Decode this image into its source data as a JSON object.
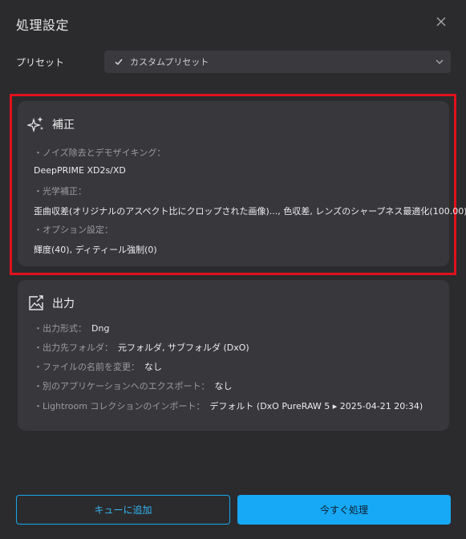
{
  "dialog": {
    "title": "処理設定"
  },
  "preset": {
    "label": "プリセット",
    "value": "カスタムプリセット"
  },
  "correction": {
    "heading": "補正",
    "noise_label": "・ノイズ除去とデモザイキング：",
    "noise_value": "DeepPRIME XD2s/XD",
    "optical_label": "・光学補正：",
    "optical_value": "歪曲収差(オリジナルのアスペクト比にクロップされた画像)..., 色収差, レンズのシャープネス最適化(100.00)",
    "options_label": "・オプション設定：",
    "options_value": "輝度(40), ディティール強制(0)"
  },
  "output": {
    "heading": "出力",
    "rows": [
      {
        "label": "・出力形式：",
        "value": "Dng"
      },
      {
        "label": "・出力先フォルダ：",
        "value": "元フォルダ, サブフォルダ (DxO)"
      },
      {
        "label": "・ファイルの名前を変更：",
        "value": "なし"
      },
      {
        "label": "・別のアプリケーションへのエクスポート：",
        "value": "なし"
      },
      {
        "label": "・Lightroom コレクションのインポート：",
        "value": "デフォルト (DxO PureRAW 5 ▸ 2025-04-21 20:34)"
      }
    ]
  },
  "buttons": {
    "queue": "キューに追加",
    "process_now": "今すぐ処理"
  },
  "colors": {
    "accent": "#17a9f5",
    "highlight": "#e0111b",
    "background": "#2b2b2e",
    "card": "#38383c"
  },
  "icons": [
    "close-icon",
    "check-icon",
    "chevron-down-icon",
    "sparkle-icon",
    "export-image-icon"
  ]
}
